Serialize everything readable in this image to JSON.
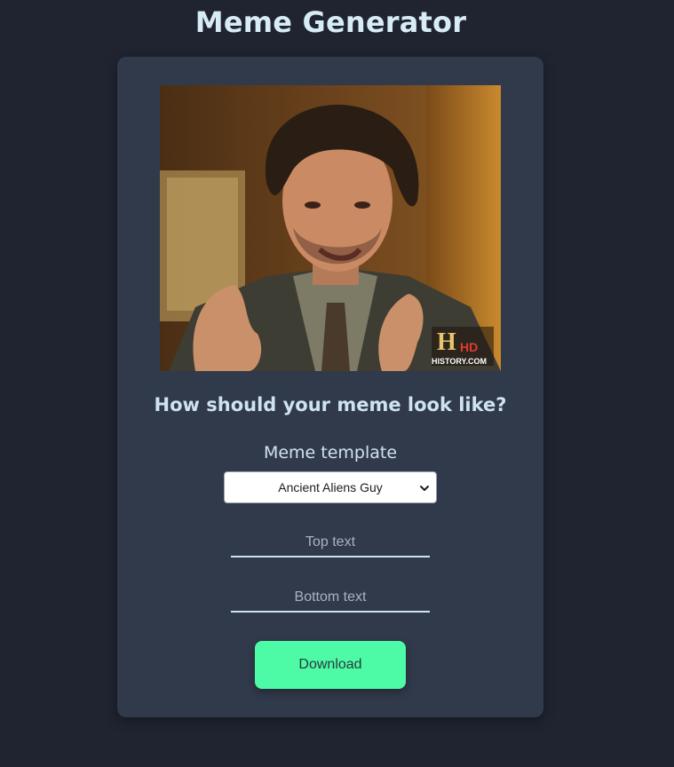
{
  "app": {
    "title": "Meme Generator"
  },
  "meme": {
    "image_description_icon": "meme-photo",
    "watermark_logo_text": "H HD HISTORY.COM"
  },
  "form": {
    "question": "How should your meme look like?",
    "template_label": "Meme template",
    "template_selected": "Ancient Aliens Guy",
    "top_text_value": "",
    "top_text_placeholder": "Top text",
    "bottom_text_value": "",
    "bottom_text_placeholder": "Bottom text",
    "download_label": "Download"
  },
  "colors": {
    "background": "#1f2430",
    "card": "#313a4b",
    "accent": "#4dfba7",
    "text": "#cfe3ef"
  }
}
